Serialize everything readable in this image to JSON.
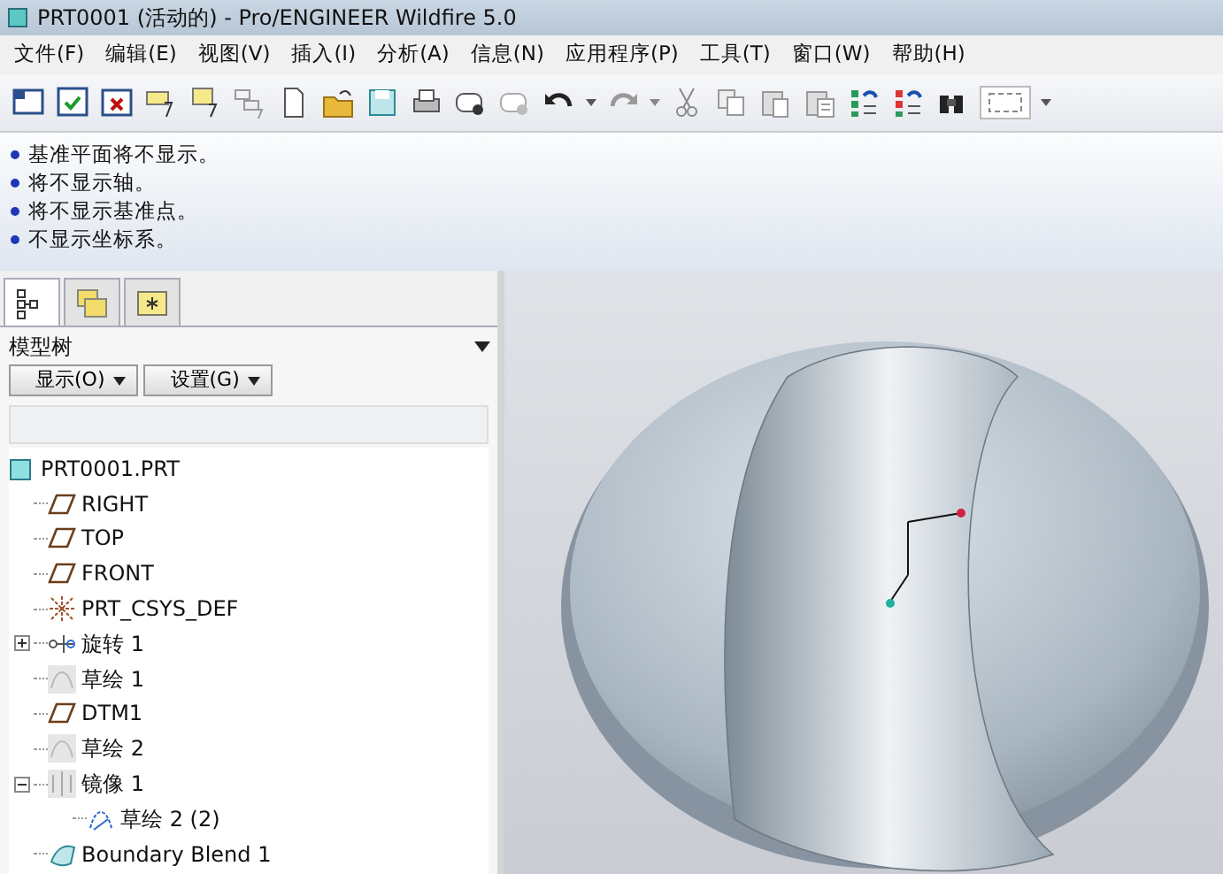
{
  "window": {
    "title": "PRT0001 (活动的) - Pro/ENGINEER Wildfire 5.0"
  },
  "menu": [
    "文件(F)",
    "编辑(E)",
    "视图(V)",
    "插入(I)",
    "分析(A)",
    "信息(N)",
    "应用程序(P)",
    "工具(T)",
    "窗口(W)",
    "帮助(H)"
  ],
  "messages": [
    "基准平面将不显示。",
    "将不显示轴。",
    "将不显示基准点。",
    "不显示坐标系。"
  ],
  "navigator_tabs": [
    {
      "kind": "model-tree",
      "selected": true
    },
    {
      "kind": "folder-browser",
      "selected": false
    },
    {
      "kind": "favorites",
      "selected": false
    }
  ],
  "model_tree": {
    "title": "模型树",
    "buttons": [
      "显示(O)",
      "设置(G)"
    ],
    "root": "PRT0001.PRT",
    "items": [
      {
        "kind": "plane",
        "label": "RIGHT"
      },
      {
        "kind": "plane",
        "label": "TOP"
      },
      {
        "kind": "plane",
        "label": "FRONT"
      },
      {
        "kind": "csys",
        "label": "PRT_CSYS_DEF"
      },
      {
        "kind": "revolve",
        "label": "旋转 1",
        "expanded": false
      },
      {
        "kind": "sketch",
        "label": "草绘 1"
      },
      {
        "kind": "plane",
        "label": "DTM1"
      },
      {
        "kind": "sketch",
        "label": "草绘 2"
      },
      {
        "kind": "mirror",
        "label": "镜像 1",
        "expanded": true,
        "children": [
          {
            "kind": "sketch-copy",
            "label": "草绘 2 (2)"
          }
        ]
      },
      {
        "kind": "blend",
        "label": "Boundary Blend 1"
      }
    ]
  }
}
